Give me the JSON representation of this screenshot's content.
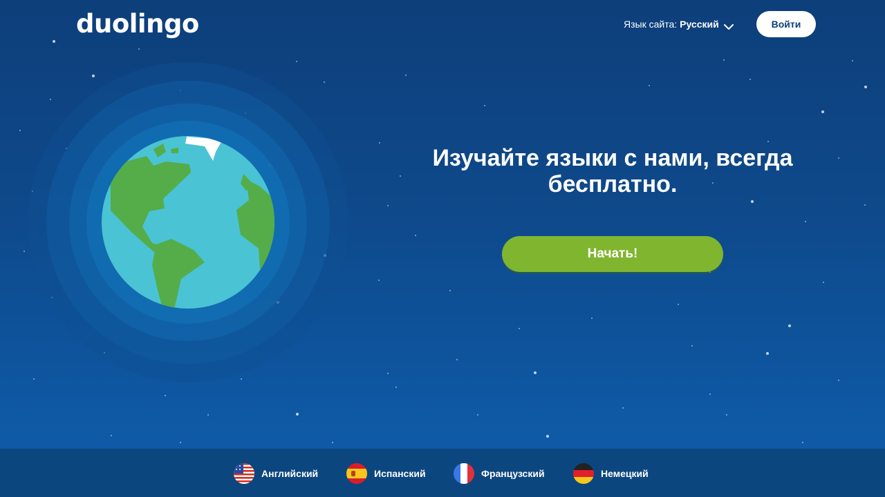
{
  "header": {
    "logo_text": "duolingo",
    "site_language_label": "Язык сайта:",
    "site_language_value": "Русский",
    "login_label": "Войти"
  },
  "hero": {
    "title_line1": "Изучайте языки с нами, всегда",
    "title_line2": "бесплатно.",
    "start_label": "Начать!"
  },
  "footer": {
    "languages": [
      {
        "label": "Английский",
        "flag": "us-flag-icon"
      },
      {
        "label": "Испанский",
        "flag": "spain-flag-icon"
      },
      {
        "label": "Французский",
        "flag": "france-flag-icon"
      },
      {
        "label": "Немецкий",
        "flag": "germany-flag-icon"
      }
    ]
  },
  "colors": {
    "background_top": "#0d3f7a",
    "background_bottom": "#0f5eae",
    "footer": "#0c467f",
    "start_button": "#80b530",
    "ocean": "#4ac3d4",
    "land": "#54ad48"
  }
}
